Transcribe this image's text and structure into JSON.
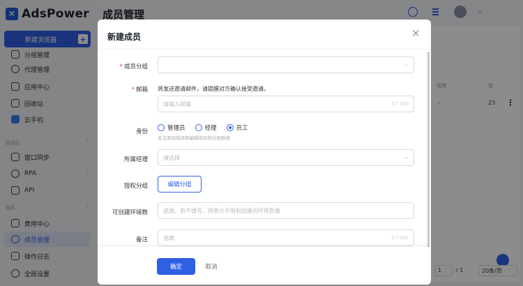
{
  "app": {
    "logo_mark": "✕",
    "name": "AdsPower"
  },
  "sidebar": {
    "new_browser_label": "新建浏览器",
    "new_browser_plus": "+",
    "items_top": [
      {
        "label": "分组管理",
        "icon": "folder-icon"
      },
      {
        "label": "代理管理",
        "icon": "proxy-icon"
      },
      {
        "label": "应用中心",
        "icon": "app-center-icon"
      },
      {
        "label": "回收站",
        "icon": "trash-icon"
      },
      {
        "label": "云手机",
        "icon": "cloud-phone-icon"
      }
    ],
    "section_automation": "自动化",
    "items_automation": [
      {
        "label": "窗口同步",
        "icon": "window-sync-icon"
      },
      {
        "label": "RPA",
        "icon": "rpa-icon"
      },
      {
        "label": "API",
        "icon": "api-icon"
      }
    ],
    "section_team": "团队",
    "items_team": [
      {
        "label": "费用中心",
        "icon": "billing-icon"
      },
      {
        "label": "成员管理",
        "icon": "members-icon",
        "active": true
      },
      {
        "label": "操作日志",
        "icon": "log-icon"
      },
      {
        "label": "全局设置",
        "icon": "settings-icon"
      }
    ]
  },
  "main": {
    "title": "成员管理",
    "bg_col_label_1": "经理",
    "bg_col_label_2": "授",
    "bg_val_1": "-",
    "bg_val_2": "23",
    "kebab": "⋮",
    "pager_page": "1",
    "pager_total": "/ 1",
    "pager_size": "20条/页"
  },
  "modal": {
    "title": "新建成员",
    "close": "✕",
    "group_label": "成员分组",
    "email_label": "邮箱",
    "email_hint": "将发送邀请邮件，请提醒对方确认接受邀请。",
    "email_placeholder": "请输入邮箱",
    "email_counter": "0 / 100",
    "role_label": "身份",
    "roles": [
      "管理员",
      "经理",
      "员工"
    ],
    "selected_role": "员工",
    "role_sub_hint": "无法添加成员和编辑成员的分组数据",
    "manager_label": "所属经理",
    "manager_placeholder": "请选择",
    "auth_group_label": "授权分组",
    "edit_group_button": "编辑分组",
    "env_limit_label": "可创建环境数",
    "env_limit_placeholder": "选填，若不填写，则表示不限制创建的环境数量",
    "remark_label": "备注",
    "remark_placeholder": "选填",
    "remark_counter": "0 / 500",
    "ok_button": "确定",
    "cancel_button": "取消",
    "required_mark": "*",
    "dropdown_arrow": "⌵"
  },
  "colors": {
    "accent": "#2f5fe3",
    "required": "#e5484d"
  }
}
